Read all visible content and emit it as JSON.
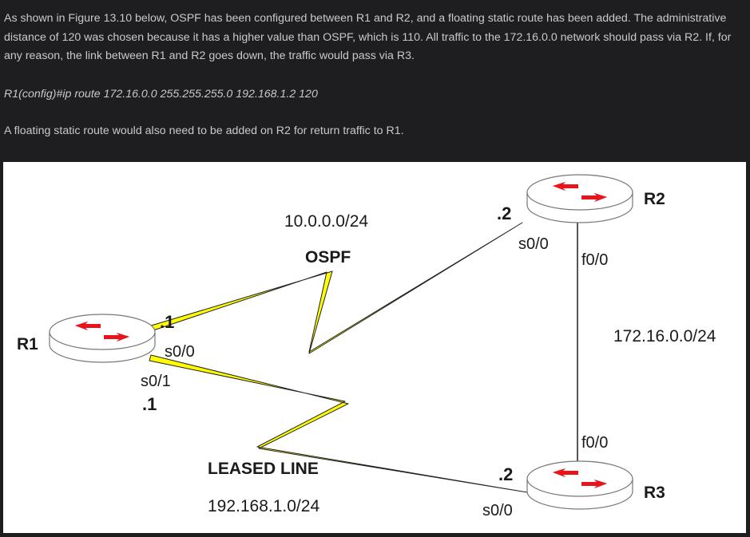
{
  "text": {
    "paragraph_1": "As shown in Figure 13.10 below, OSPF has been configured between R1 and R2, and a floating static route has been added. The administrative distance of 120 was chosen because it has a higher value than OSPF, which is 110. All traffic to the 172.16.0.0 network should pass via R2. If, for any reason, the link between R1 and R2 goes down, the traffic would pass via R3.",
    "command": "R1(config)#ip route 172.16.0.0 255.255.255.0 192.168.1.2 120",
    "paragraph_2": "A floating static route would also need to be added on R2 for return traffic to R1."
  },
  "diagram": {
    "routers": {
      "r1": "R1",
      "r2": "R2",
      "r3": "R3"
    },
    "links": {
      "r1_r2": {
        "network": "10.0.0.0/24",
        "protocol": "OSPF",
        "r1_ip": ".1",
        "r1_iface": "s0/0",
        "r2_ip": ".2",
        "r2_iface": "s0/0"
      },
      "r1_r3": {
        "type": "LEASED LINE",
        "network": "192.168.1.0/24",
        "r1_iface": "s0/1",
        "r1_ip": ".1",
        "r3_ip": ".2",
        "r3_iface": "s0/0"
      },
      "r2_r3": {
        "network": "172.16.0.0/24",
        "r2_iface": "f0/0",
        "r3_iface": "f0/0"
      }
    },
    "colors": {
      "serial_link": "#ffff00",
      "router_arrows": "#e8141b",
      "router_body": "#ffffff"
    }
  }
}
